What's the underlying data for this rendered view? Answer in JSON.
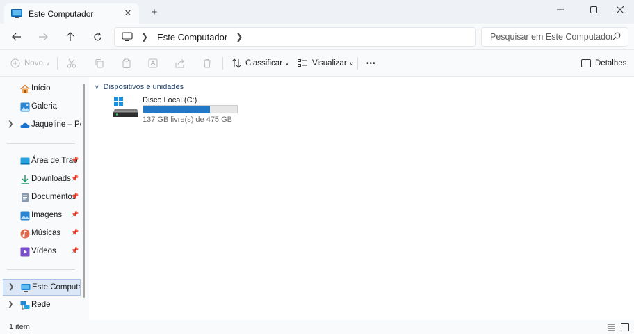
{
  "window": {
    "tab_title": "Este Computador",
    "tab_close": "✕",
    "new_tab": "+",
    "minimize": "minimize-icon",
    "maximize": "maximize-icon",
    "close": "close-icon"
  },
  "nav": {
    "breadcrumb": "Este Computador",
    "search_placeholder": "Pesquisar em Este Computador"
  },
  "toolbar": {
    "new_label": "Novo",
    "sort_label": "Classificar",
    "view_label": "Visualizar",
    "more_label": "•••",
    "details_label": "Detalhes"
  },
  "sidebar": {
    "items": [
      {
        "label": "Início",
        "icon": "home-icon",
        "pinned": false,
        "expandable": false
      },
      {
        "label": "Galeria",
        "icon": "gallery-icon",
        "pinned": false,
        "expandable": false
      },
      {
        "label": "Jaqueline – Pess",
        "icon": "onedrive-icon",
        "pinned": false,
        "expandable": true
      },
      {
        "label": "Área de Trab",
        "icon": "desktop-icon",
        "pinned": true,
        "expandable": false
      },
      {
        "label": "Downloads",
        "icon": "download-icon",
        "pinned": true,
        "expandable": false
      },
      {
        "label": "Documentos",
        "icon": "documents-icon",
        "pinned": true,
        "expandable": false
      },
      {
        "label": "Imagens",
        "icon": "pictures-icon",
        "pinned": true,
        "expandable": false
      },
      {
        "label": "Músicas",
        "icon": "music-icon",
        "pinned": true,
        "expandable": false
      },
      {
        "label": "Vídeos",
        "icon": "videos-icon",
        "pinned": true,
        "expandable": false
      },
      {
        "label": "Este Computador",
        "icon": "this-pc-icon",
        "pinned": false,
        "expandable": true,
        "selected": true
      },
      {
        "label": "Rede",
        "icon": "network-icon",
        "pinned": false,
        "expandable": true
      }
    ]
  },
  "content": {
    "group_title": "Dispositivos e unidades",
    "drive": {
      "name": "Disco Local (C:)",
      "free_text": "137 GB livre(s) de 475 GB",
      "used_fraction": 0.71
    }
  },
  "status": {
    "item_count": "1 item"
  },
  "colors": {
    "accent": "#2178c7",
    "selected_bg": "#dbe7f6",
    "chrome_bg": "#f9fafc"
  }
}
